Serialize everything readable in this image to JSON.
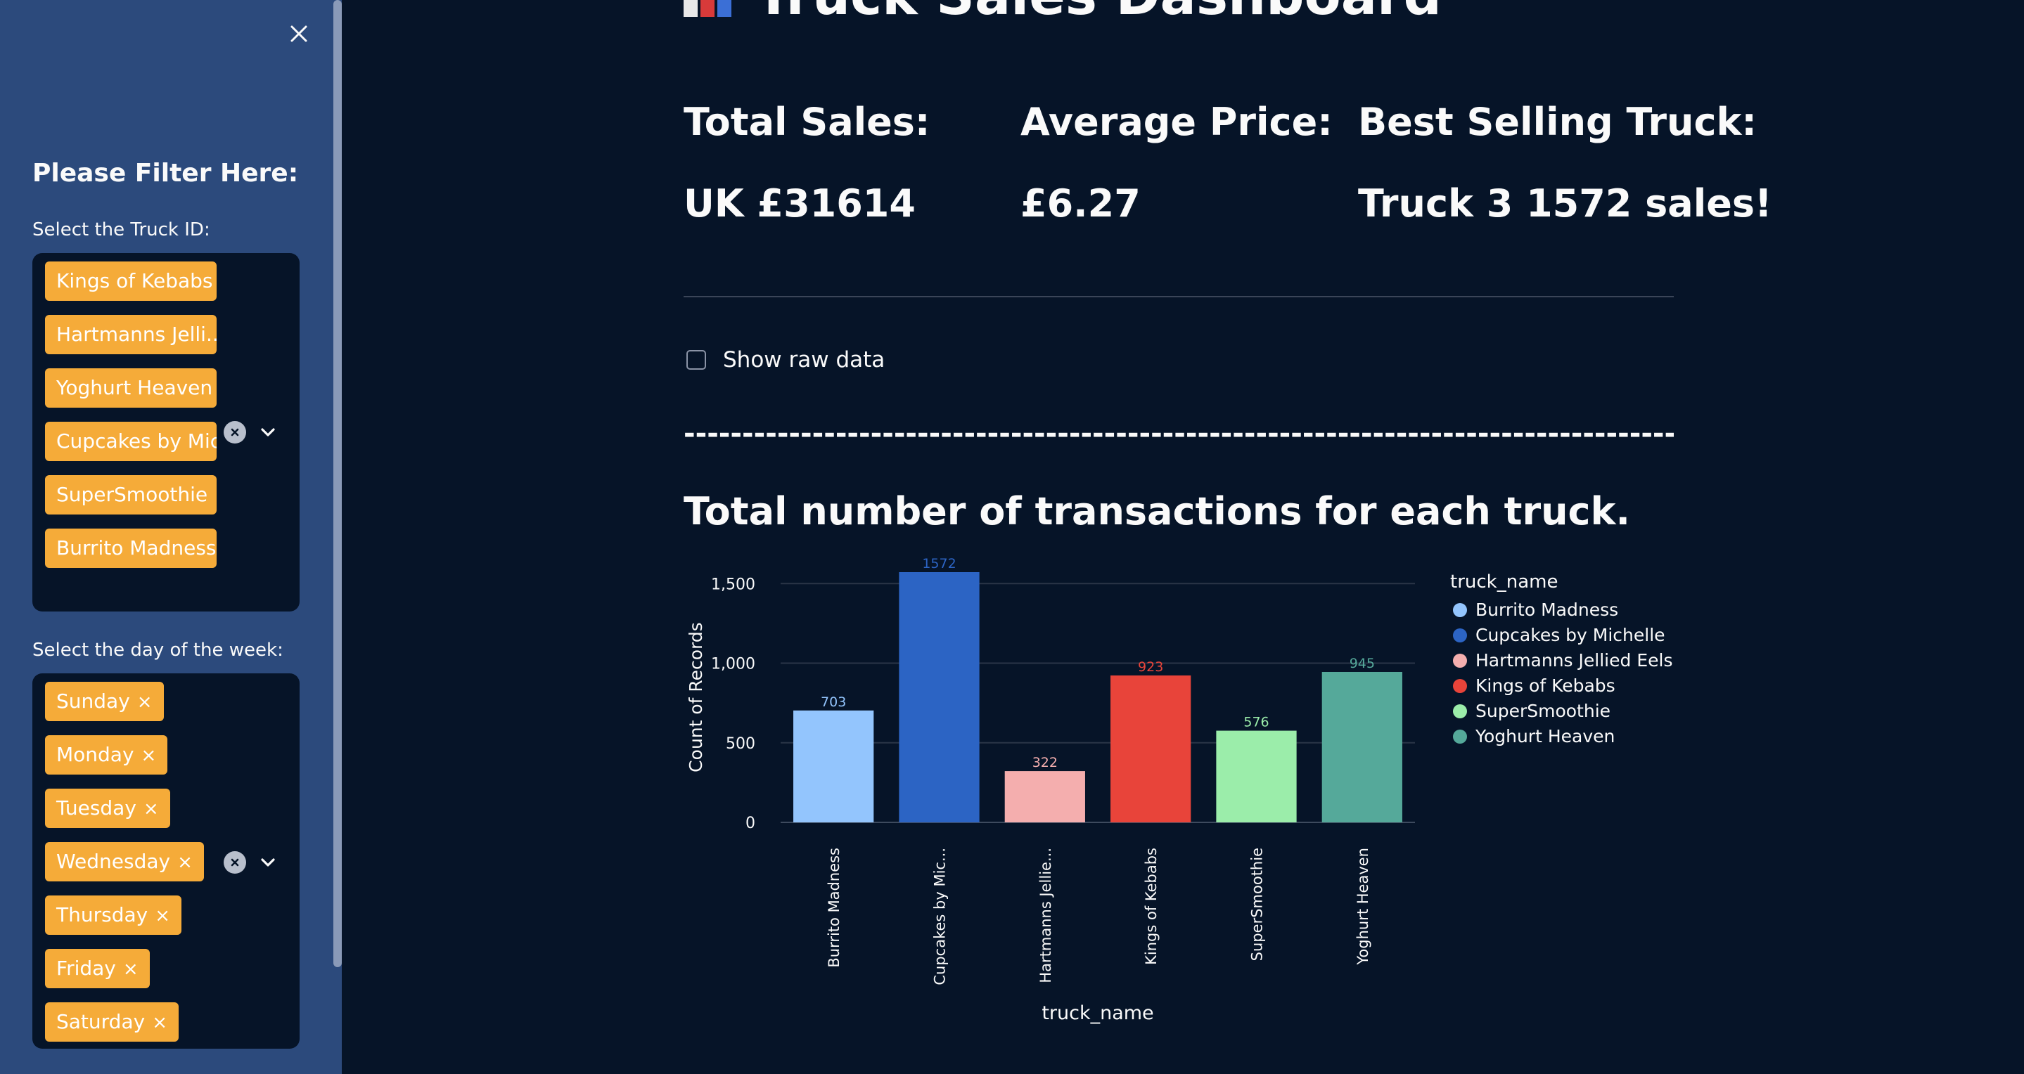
{
  "page": {
    "title": "Truck Sales Dashboard"
  },
  "sidebar": {
    "heading": "Please Filter Here:",
    "truck_filter": {
      "label": "Select the Truck ID:",
      "chips": [
        "Kings of Kebabs",
        "Hartmanns Jelli...",
        "Yoghurt Heaven",
        "Cupcakes by Mic...",
        "SuperSmoothie",
        "Burrito Madness"
      ]
    },
    "day_filter": {
      "label": "Select the day of the week:",
      "chips": [
        "Sunday",
        "Monday",
        "Tuesday",
        "Wednesday",
        "Thursday",
        "Friday",
        "Saturday"
      ],
      "remove_glyph": "×"
    }
  },
  "kpis": [
    {
      "label": "Total Sales:",
      "value": "UK £31614"
    },
    {
      "label": "Average Price:",
      "value": "£6.27"
    },
    {
      "label": "Best Selling Truck:",
      "value": "Truck 3 1572 sales!"
    }
  ],
  "raw_data_toggle": {
    "label": "Show raw data",
    "checked": false
  },
  "separator_text": "-----------------------------------------------------------------------------------------------------",
  "chart_section_title": "Total number of transactions for each truck.",
  "colors": {
    "background": "#061428",
    "sidebar": "#2c4a7c",
    "chip": "#f5ab39"
  },
  "chart_data": {
    "type": "bar",
    "categories": [
      "Burrito Madness",
      "Cupcakes by Michelle",
      "Hartmanns Jellied Eels",
      "Kings of Kebabs",
      "SuperSmoothie",
      "Yoghurt Heaven"
    ],
    "tick_labels": [
      "Burrito Madness",
      "Cupcakes by Mic...",
      "Hartmanns Jellie...",
      "Kings of Kebabs",
      "SuperSmoothie",
      "Yoghurt Heaven"
    ],
    "values": [
      703,
      1572,
      322,
      923,
      576,
      945
    ],
    "colors": [
      "#93c5fd",
      "#2c64c4",
      "#f4aeae",
      "#e8443a",
      "#9bedaa",
      "#55a99a"
    ],
    "xlabel": "truck_name",
    "ylabel": "Count of Records",
    "yticks": [
      0,
      500,
      1000,
      1500
    ],
    "ytick_labels": [
      "0",
      "500",
      "1,000",
      "1,500"
    ],
    "ylim": [
      0,
      1572
    ],
    "legend_title": "truck_name",
    "legend_position": "right",
    "grid": true
  }
}
